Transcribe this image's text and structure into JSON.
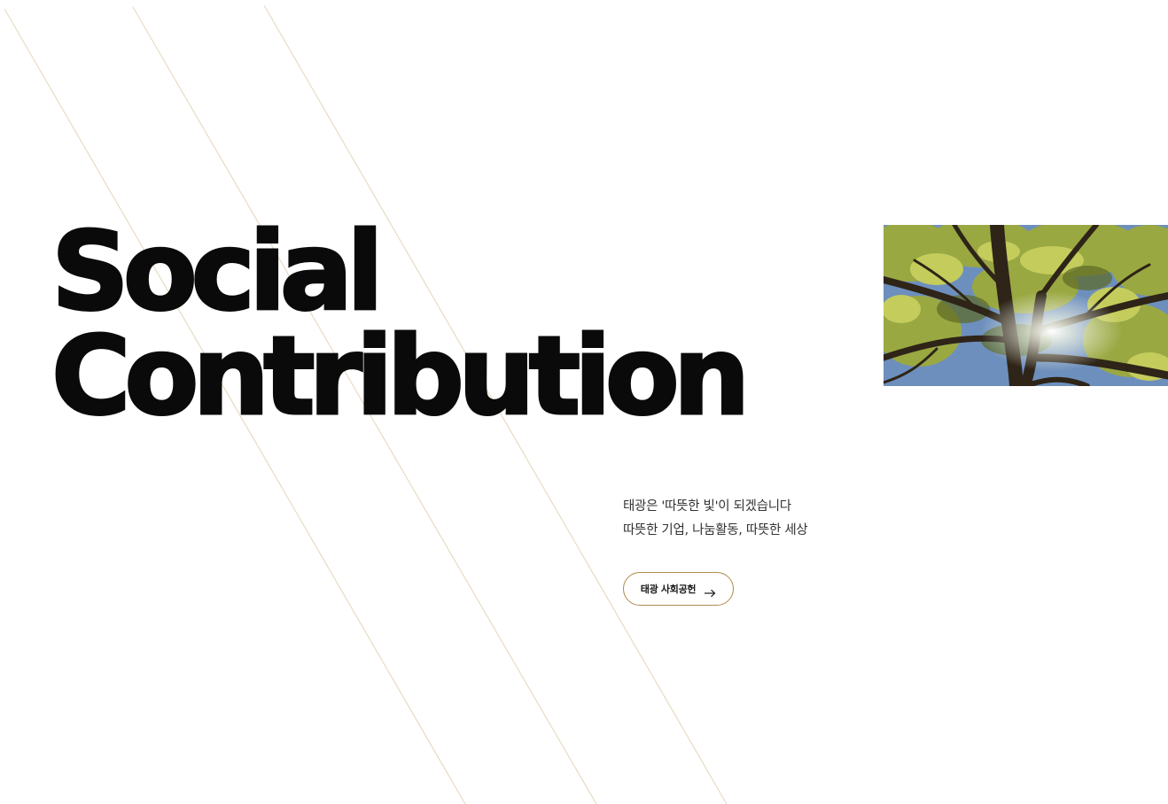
{
  "hero": {
    "headline_line1": "Social",
    "headline_line2": "Contribution",
    "tagline_line1": "태광은 '따뜻한 빛'이 되겠습니다",
    "tagline_line2": "따뜻한 기업, 나눔활동, 따뜻한 세상",
    "cta_label": "태광 사회공헌",
    "cta_icon": "arrow-right-icon",
    "image_subject": "tree-canopy-photo"
  },
  "colors": {
    "background": "#ffffff",
    "headline": "#0a0a0a",
    "accent": "#b08a4e",
    "decor_line": "#e8dcc2"
  }
}
